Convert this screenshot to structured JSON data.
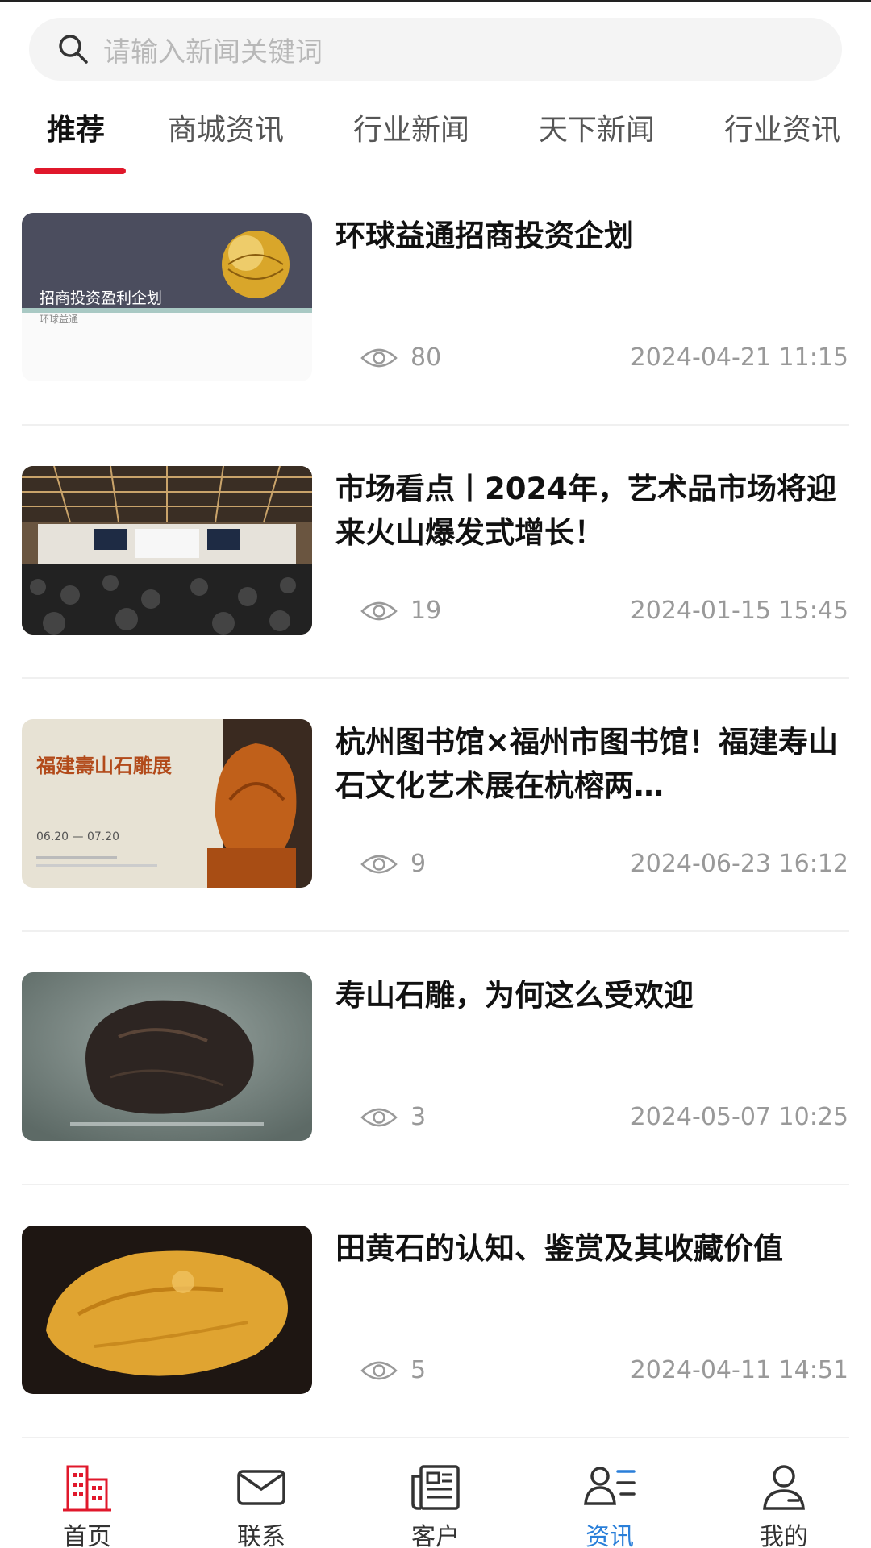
{
  "search": {
    "placeholder": "请输入新闻关键词"
  },
  "tabs": [
    {
      "label": "推荐",
      "active": true
    },
    {
      "label": "商城资讯"
    },
    {
      "label": "行业新闻"
    },
    {
      "label": "天下新闻"
    },
    {
      "label": "行业资讯"
    }
  ],
  "news": [
    {
      "title": "环球益通招商投资企划",
      "views": "80",
      "date": "2024-04-21 11:15",
      "thumb": {
        "kind": "slide",
        "caption": "招商投资盈利企划",
        "subcaption": "环球益通"
      }
    },
    {
      "title": "市场看点丨2024年，艺术品市场将迎来火山爆发式增长！",
      "views": "19",
      "date": "2024-01-15 15:45",
      "thumb": {
        "kind": "auction-hall"
      }
    },
    {
      "title": "杭州图书馆×福州市图书馆！福建寿山石文化艺术展在杭榕两…",
      "views": "9",
      "date": "2024-06-23 16:12",
      "thumb": {
        "kind": "poster",
        "caption": "福建壽山石雕展",
        "dates": "06.20 — 07.20"
      }
    },
    {
      "title": "寿山石雕，为何这么受欢迎",
      "views": "3",
      "date": "2024-05-07 10:25",
      "thumb": {
        "kind": "stone-dark"
      }
    },
    {
      "title": "田黄石的认知、鉴赏及其收藏价值",
      "views": "5",
      "date": "2024-04-11 14:51",
      "thumb": {
        "kind": "stone-yellow"
      }
    }
  ],
  "nav": [
    {
      "label": "首页",
      "icon": "home-building-icon",
      "color": "#e0182b"
    },
    {
      "label": "联系",
      "icon": "mail-icon"
    },
    {
      "label": "客户",
      "icon": "newspaper-icon"
    },
    {
      "label": "资讯",
      "icon": "profile-list-icon",
      "active": true,
      "color": "#2a7fd9"
    },
    {
      "label": "我的",
      "icon": "user-icon"
    }
  ],
  "colors": {
    "accent": "#e0182b",
    "active_nav": "#2a7fd9",
    "muted": "#999999"
  }
}
